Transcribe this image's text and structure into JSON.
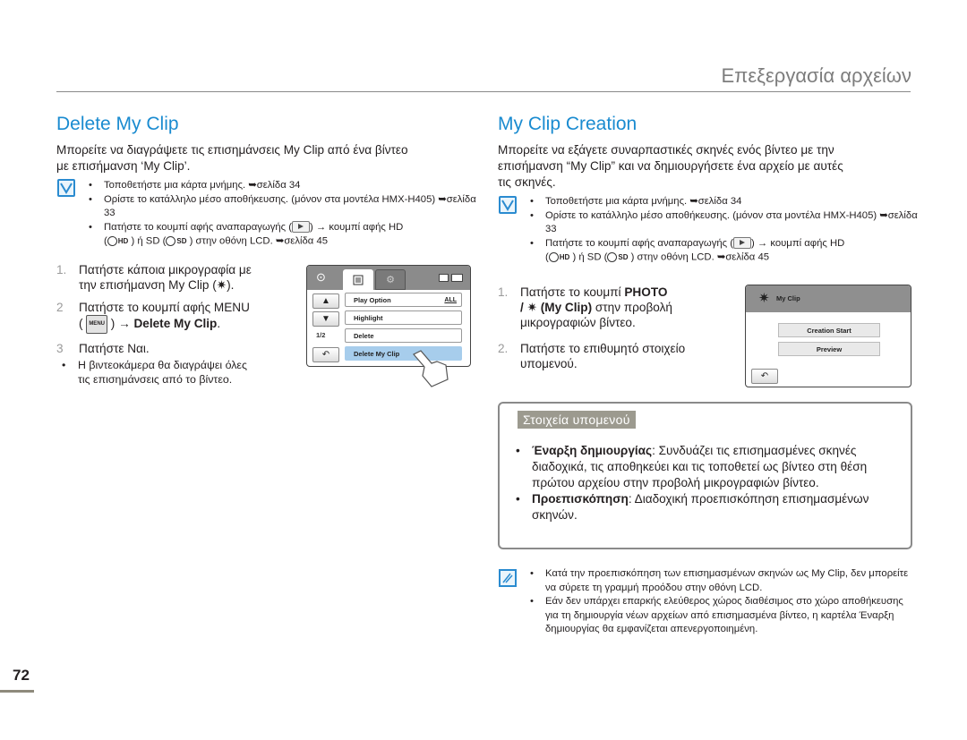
{
  "header": {
    "title": "Επεξεργασία αρχείων"
  },
  "left": {
    "title": "Delete My Clip",
    "intro": [
      "Μπορείτε να διαγράψετε τις επισημάνσεις My Clip από ένα βίντεο",
      "με επισήμανση ‘My Clip’."
    ],
    "prereq": {
      "icon": "checkbox-icon",
      "items": [
        "Τοποθετήστε μια κάρτα μνήμης. ➥σελίδα 34",
        "Ορίστε το κατάλληλο μέσο αποθήκευσης. (μόνον στα μοντέλα HMX-H405) ➥σελίδα 33"
      ],
      "play_item_a": "Πατήστε το κουμπί αφής αναπαραγωγής (",
      "play_item_b": ") → κουμπί αφής HD",
      "play_item_c": "(",
      "hd": "HD",
      "play_item_d": ") ή SD (",
      "sd": "SD",
      "play_item_e": ") στην οθόνη LCD. ➥σελίδα 45"
    },
    "steps": [
      {
        "num": "1.",
        "text_a": "Πατήστε κάποια μικρογραφία με",
        "text_b": "την επισήμανση My Clip (",
        "text_c": ")."
      },
      {
        "num": "2",
        "text_a": "Πατήστε το κουμπί αφής MENU",
        "menu_chip": "MENU",
        "text_b": ") → ",
        "bold": "Delete My Clip",
        "text_c": "."
      },
      {
        "num": "3",
        "text_a": "Πατήστε Ναι."
      }
    ],
    "step3_sub": [
      "Η βιντεοκάμερα θα διαγράψει όλες",
      "τις επισημάνσεις από το βίντεο."
    ],
    "lcd": {
      "page": "1/2",
      "items": [
        "Play Option",
        "Highlight",
        "Delete",
        "Delete My Clip"
      ],
      "play_option_value": "ALL",
      "selected_index": 3
    }
  },
  "right": {
    "title": "My Clip Creation",
    "intro": [
      "Μπορείτε να εξάγετε συναρπαστικές σκηνές ενός βίντεο με την",
      "επισήμανση “My Clip” και να δημιουργήσετε ένα αρχείο με αυτές",
      "τις σκηνές."
    ],
    "prereq": {
      "items": [
        "Τοποθετήστε μια κάρτα μνήμης. ➥σελίδα 34",
        "Ορίστε το κατάλληλο μέσο αποθήκευσης. (μόνον στα μοντέλα HMX-H405) ➥σελίδα 33"
      ],
      "play_item_a": "Πατήστε το κουμπί αφής αναπαραγωγής (",
      "play_item_b": ") → κουμπί αφής HD",
      "play_item_c": "(",
      "hd": "HD",
      "play_item_d": ") ή SD (",
      "sd": "SD",
      "play_item_e": ") στην οθόνη LCD. ➥σελίδα 45"
    },
    "steps": [
      {
        "num": "1.",
        "text_a": "Πατήστε το κουμπί ",
        "bold_a": "PHOTO",
        "text_b": "/ ",
        "bold_b": "(My Clip)",
        "text_c": " στην προβολή",
        "text_d": "μικρογραφιών βίντεο."
      },
      {
        "num": "2.",
        "text_a": "Πατήστε το επιθυμητό στοιχείο",
        "text_b": "υπομενού."
      }
    ],
    "lcd": {
      "title": "My Clip",
      "buttons": [
        "Creation Start",
        "Preview"
      ]
    },
    "submenu": {
      "label": "Στοιχεία υπομενού",
      "items": [
        {
          "term": "Έναρξη δημιουργίας",
          "desc": ": Συνδυάζει τις επισημασμένες σκηνές διαδοχικά, τις αποθηκεύει και τις τοποθετεί ως βίντεο στη θέση πρώτου αρχείου στην προβολή μικρογραφιών βίντεο."
        },
        {
          "term": "Προεπισκόπηση",
          "desc": ": Διαδοχική προεπισκόπηση επισημασμένων σκηνών."
        }
      ]
    },
    "notes": [
      "Κατά την προεπισκόπηση των επισημασμένων σκηνών ως My Clip, δεν μπορείτε να σύρετε τη γραμμή προόδου στην οθόνη LCD.",
      "Εάν δεν υπάρχει επαρκής ελεύθερος χώρος διαθέσιμος στο χώρο αποθήκευσης για τη δημιουργία νέων αρχείων από επισημασμένα βίντεο, η καρτέλα Έναρξη δημιουργίας θα εμφανίζεται απενεργοποιημένη."
    ]
  },
  "footer": {
    "page_number": "72"
  },
  "colors": {
    "accent": "#1a8bd0",
    "header_gray": "#7d7d7d",
    "submenu_label_bg": "#9c9a8f",
    "lcd_selected": "#a7cdec"
  }
}
